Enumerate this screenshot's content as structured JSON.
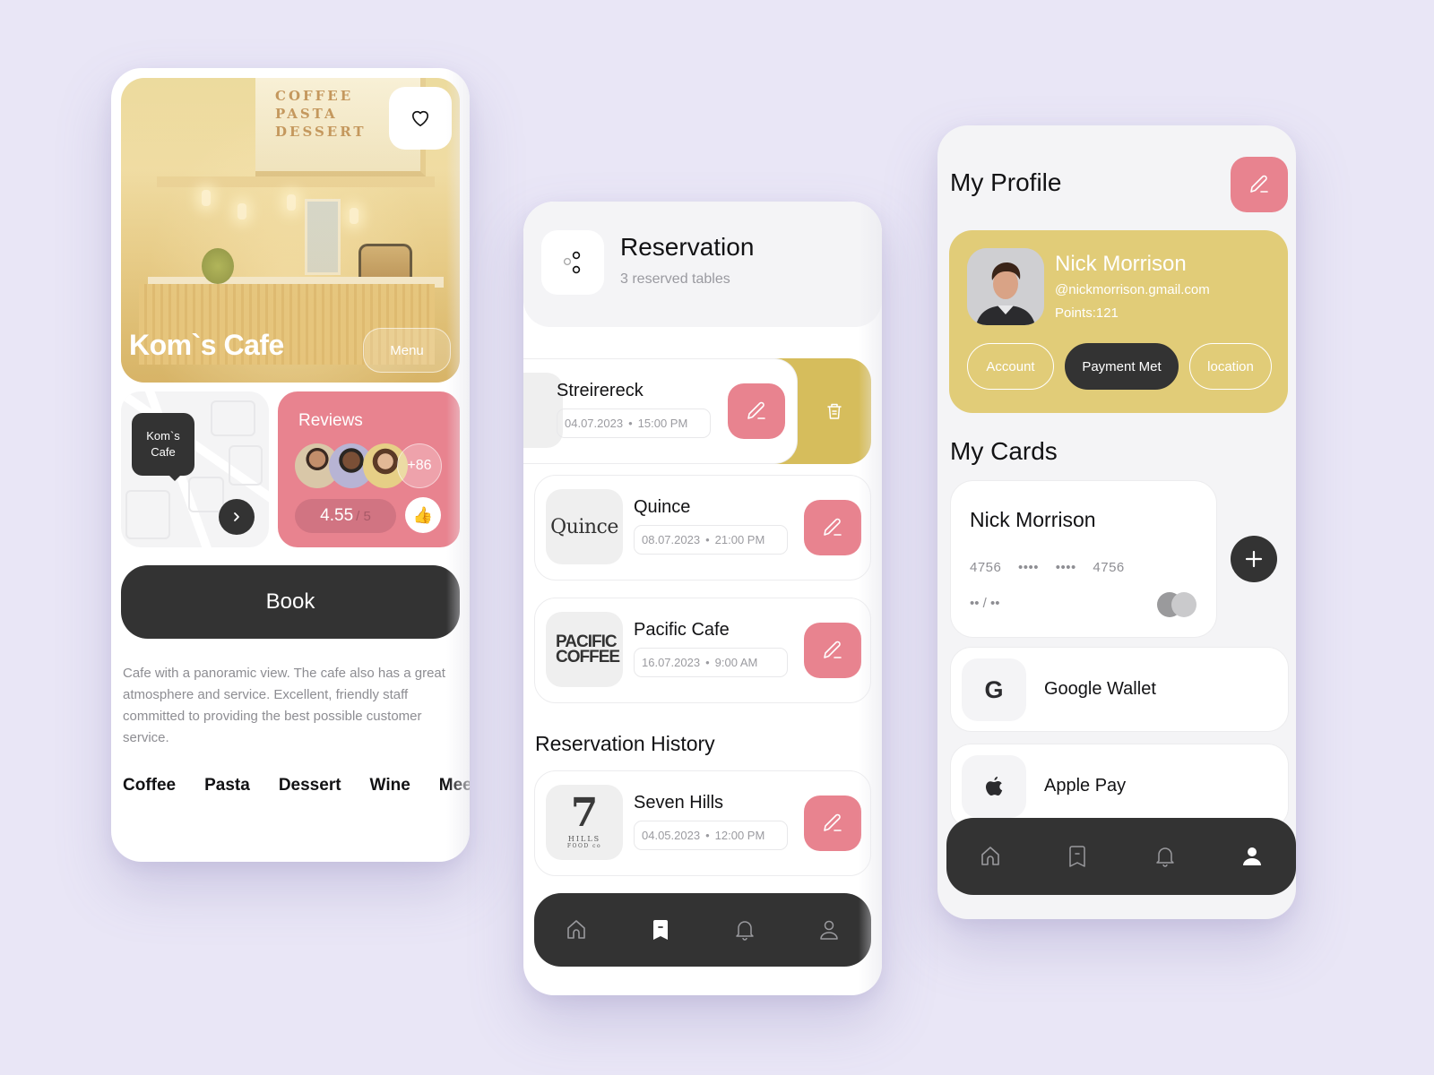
{
  "colors": {
    "background": "#e9e6f6",
    "accent_pink": "#e8838f",
    "accent_gold": "#e1cc78",
    "dark": "#333333"
  },
  "cafe_screen": {
    "hero": {
      "title": "Kom`s Cafe",
      "sign_lines": [
        "COFFEE",
        "PASTA",
        "DESSERT"
      ],
      "menu_label": "Menu",
      "favorite_icon": "heart-icon"
    },
    "map": {
      "pin_label": "Kom`s Cafe",
      "next_icon": "chevron-right-icon"
    },
    "reviews": {
      "title": "Reviews",
      "more_count": "+86",
      "rating": "4.55",
      "rating_max": "/ 5",
      "like_icon": "thumbs-up-icon"
    },
    "book_label": "Book",
    "description": "Cafe with a panoramic view. The cafe also has a great atmosphere and service. Excellent, friendly staff committed to providing the best possible customer service.",
    "categories": [
      "Coffee",
      "Pasta",
      "Dessert",
      "Wine",
      "Meet"
    ]
  },
  "reservation_screen": {
    "title": "Reservation",
    "subtitle": "3 reserved tables",
    "reservations": [
      {
        "name": "Streirereck",
        "date": "04.07.2023",
        "time": "15:00 PM",
        "logo": ""
      },
      {
        "name": "Quince",
        "date": "08.07.2023",
        "time": "21:00 PM",
        "logo": "Quince"
      },
      {
        "name": "Pacific Cafe",
        "date": "16.07.2023",
        "time": "9:00 AM",
        "logo": "PACIFIC COFFEE"
      }
    ],
    "history_title": "Reservation History",
    "history": [
      {
        "name": "Seven Hills",
        "date": "04.05.2023",
        "time": "12:00 PM",
        "logo_num": "7",
        "logo_text": "HILLS",
        "logo_sub": "FOOD co"
      }
    ],
    "separator": "•",
    "nav": [
      "home-icon",
      "bookmark-icon",
      "bell-icon",
      "user-icon"
    ],
    "nav_active": "bookmark-icon"
  },
  "profile_screen": {
    "title": "My Profile",
    "user": {
      "name": "Nick Morrison",
      "email": "@nickmorrison.gmail.com",
      "points": "Points:121"
    },
    "tabs": [
      {
        "label": "Account",
        "active": false
      },
      {
        "label": "Payment Met",
        "active": true
      },
      {
        "label": "location",
        "active": false
      }
    ],
    "cards_title": "My Cards",
    "card": {
      "holder": "Nick Morrison",
      "number": "4756 •••• •••• 4756",
      "expiry": "•• / ••"
    },
    "wallets": [
      {
        "label": "Google Wallet",
        "icon": "google-icon"
      },
      {
        "label": "Apple Pay",
        "icon": "apple-icon"
      }
    ],
    "nav": [
      "home-icon",
      "bookmark-icon",
      "bell-icon",
      "user-icon"
    ],
    "nav_active": "user-icon"
  }
}
